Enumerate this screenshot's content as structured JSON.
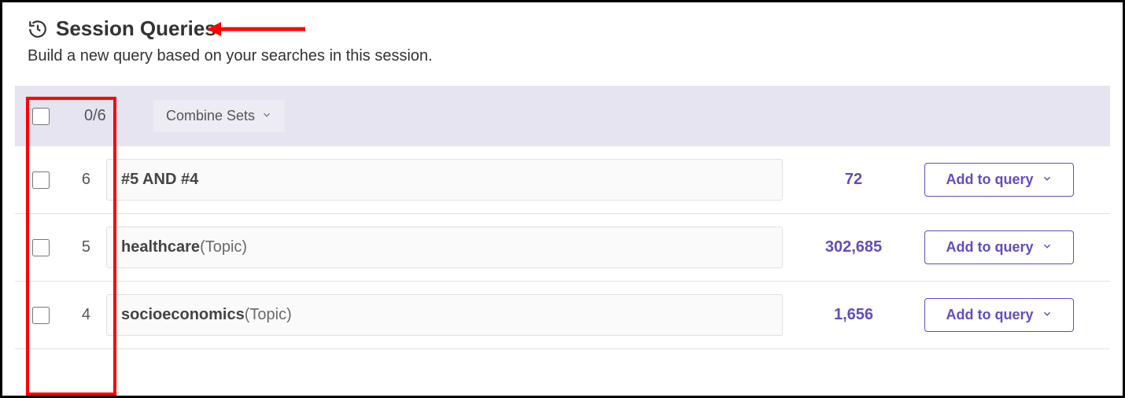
{
  "header": {
    "title": "Session Queries",
    "subtitle": "Build a new query based on your searches in this session."
  },
  "toolbar": {
    "selection_count": "0/6",
    "combine_label": "Combine Sets"
  },
  "buttons": {
    "add_to_query": "Add to query"
  },
  "rows": [
    {
      "num": "6",
      "query_bold": "#5 AND #4",
      "query_light": "",
      "count": "72"
    },
    {
      "num": "5",
      "query_bold": "healthcare",
      "query_light": " (Topic)",
      "count": "302,685"
    },
    {
      "num": "4",
      "query_bold": "socioeconomics",
      "query_light": " (Topic)",
      "count": "1,656"
    }
  ]
}
